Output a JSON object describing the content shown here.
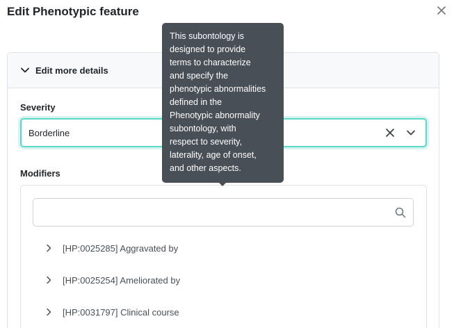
{
  "modal": {
    "title": "Edit Phenotypic feature",
    "close_icon": "close-icon"
  },
  "panel": {
    "header_label": "Edit more details",
    "header_icon": "chevron-down-icon"
  },
  "severity": {
    "label": "Severity",
    "value": "Borderline",
    "clear_icon": "clear-icon",
    "dropdown_icon": "chevron-down-icon",
    "focus_color": "#5cd6c5"
  },
  "modifiers": {
    "label": "Modifiers",
    "search_placeholder": "",
    "search_icon": "search-icon",
    "items": [
      {
        "label": "[HP:0025285] Aggravated by"
      },
      {
        "label": "[HP:0025254] Ameliorated by"
      },
      {
        "label": "[HP:0031797] Clinical course"
      }
    ]
  },
  "tooltip": {
    "lines": [
      "This subontology is",
      "designed to provide",
      "terms to characterize",
      "and specify the",
      "phenotypic abnormalities",
      "defined in the",
      "Phenotypic abnormality",
      "subontology, with",
      "respect to severity,",
      "laterality, age of onset,",
      "and other aspects."
    ],
    "background": "#494f57"
  }
}
